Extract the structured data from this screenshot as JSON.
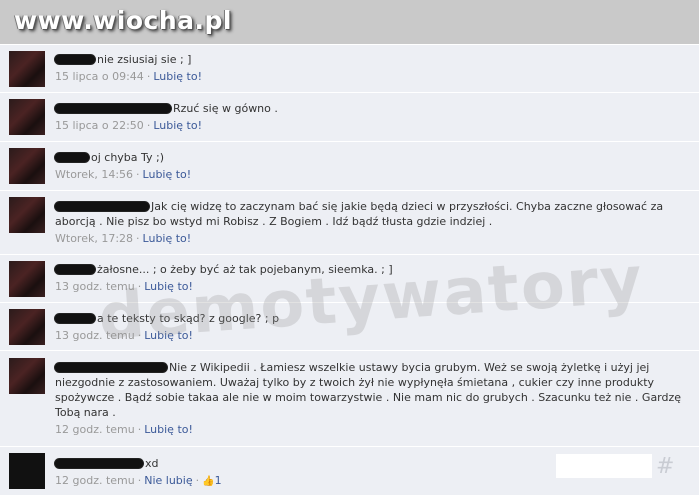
{
  "site": {
    "logo": "www.wiocha.pl"
  },
  "watermark": "demotywatory",
  "comments": [
    {
      "text": "nie zsiusiaj sie ; ]",
      "time": "15 lipca o 09:44",
      "like": "Lubię to!"
    },
    {
      "text": "Rzuć się w gówno .",
      "time": "15 lipca o 22:50",
      "like": "Lubię to!"
    },
    {
      "text": "oj chyba Ty ;)",
      "time": "Wtorek, 14:56",
      "like": "Lubię to!"
    },
    {
      "text": "Jak cię widzę to zaczynam bać się jakie będą dzieci w przyszłości. Chyba zaczne głosować za aborcją . Nie pisz bo wstyd mi Robisz . Z Bogiem . Idź bądź tłusta gdzie indziej .",
      "time": "Wtorek, 17:28",
      "like": "Lubię to!"
    },
    {
      "text": "żałosne... ; o żeby być aż tak pojebanym, sieemka. ; ]",
      "time": "13 godz. temu",
      "like": "Lubię to!"
    },
    {
      "text": "a te teksty to skąd? z google? ; p",
      "time": "13 godz. temu",
      "like": "Lubię to!"
    },
    {
      "text": "Nie z Wikipedii . Łamiesz wszelkie ustawy bycia grubym. Weż se swoją żyletkę i użyj jej niezgodnie z zastosowaniem. Uważaj tylko by z twoich żył nie wypłynęła śmietana , cukier czy inne produkty spożywcze . Bądź sobie takaa ale nie w moim towarzystwie . Nie mam nic do grubych . Szacunku też nie . Gardzę Tobą nara .",
      "time": "12 godz. temu",
      "like": "Lubię to!"
    },
    {
      "text": "xd",
      "time": "12 godz. temu",
      "like": "Nie lubię",
      "like_count": "1"
    }
  ]
}
